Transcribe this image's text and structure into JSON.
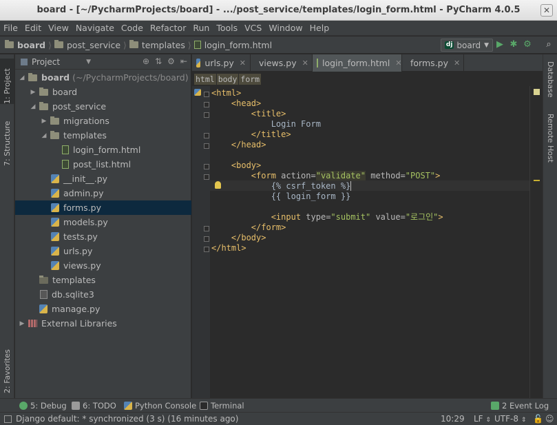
{
  "window": {
    "title": "board - [~/PycharmProjects/board] - .../post_service/templates/login_form.html - PyCharm 4.0.5"
  },
  "menu": [
    "File",
    "Edit",
    "View",
    "Navigate",
    "Code",
    "Refactor",
    "Run",
    "Tools",
    "VCS",
    "Window",
    "Help"
  ],
  "nav": {
    "crumbs": [
      "board",
      "post_service",
      "templates",
      "login_form.html"
    ],
    "run_config": "board",
    "run_config_badge": "dj"
  },
  "left_stripe": {
    "project": "1: Project",
    "structure": "7: Structure",
    "favorites": "2: Favorites"
  },
  "right_stripe": {
    "database": "Database",
    "remote_host": "Remote Host"
  },
  "project_panel": {
    "title": "Project",
    "tree": [
      {
        "label": "board",
        "suffix": "(~/PycharmProjects/board)"
      },
      {
        "label": "board"
      },
      {
        "label": "post_service"
      },
      {
        "label": "migrations"
      },
      {
        "label": "templates"
      },
      {
        "label": "login_form.html"
      },
      {
        "label": "post_list.html"
      },
      {
        "label": "__init__.py"
      },
      {
        "label": "admin.py"
      },
      {
        "label": "forms.py"
      },
      {
        "label": "models.py"
      },
      {
        "label": "tests.py"
      },
      {
        "label": "urls.py"
      },
      {
        "label": "views.py"
      },
      {
        "label": "templates"
      },
      {
        "label": "db.sqlite3"
      },
      {
        "label": "manage.py"
      },
      {
        "label": "External Libraries"
      }
    ]
  },
  "editor": {
    "tabs": [
      "urls.py",
      "views.py",
      "login_form.html",
      "forms.py"
    ],
    "active_tab": "login_form.html",
    "tag_path": [
      "html",
      "body",
      "form"
    ],
    "code": {
      "l1_open": "<html>",
      "l2_open": "<head>",
      "l3_open": "<title>",
      "l4_text": "Login Form",
      "l5_close": "</title>",
      "l6_close": "</head>",
      "l8_open": "<body>",
      "l9_form_tag": "<form",
      "l9_attr1": "action=",
      "l9_val1": "\"validate\"",
      "l9_attr2": "method=",
      "l9_val2": "\"POST\"",
      "l9_end": ">",
      "l10_text": "{% csrf_token %}",
      "l11_text": "{{ login_form }}",
      "l13_input_tag": "<input",
      "l13_attr1": "type=",
      "l13_val1": "\"submit\"",
      "l13_attr2": "value=",
      "l13_val2": "\"로그인\"",
      "l13_end": ">",
      "l14_close": "</form>",
      "l15_close": "</body>",
      "l16_close": "</html>"
    }
  },
  "bottom_tools": {
    "debug": "5: Debug",
    "todo": "6: TODO",
    "python_console": "Python Console",
    "terminal": "Terminal",
    "event_log": "2 Event Log"
  },
  "status": {
    "message": "Django default: * synchronized (3 s) (16 minutes ago)",
    "position": "10:29",
    "line_sep": "LF",
    "encoding": "UTF-8"
  },
  "colors": {
    "accent_selection": "#0d293e",
    "tag": "#e8bf6a",
    "string": "#a5c261",
    "background": "#2b2b2b"
  }
}
